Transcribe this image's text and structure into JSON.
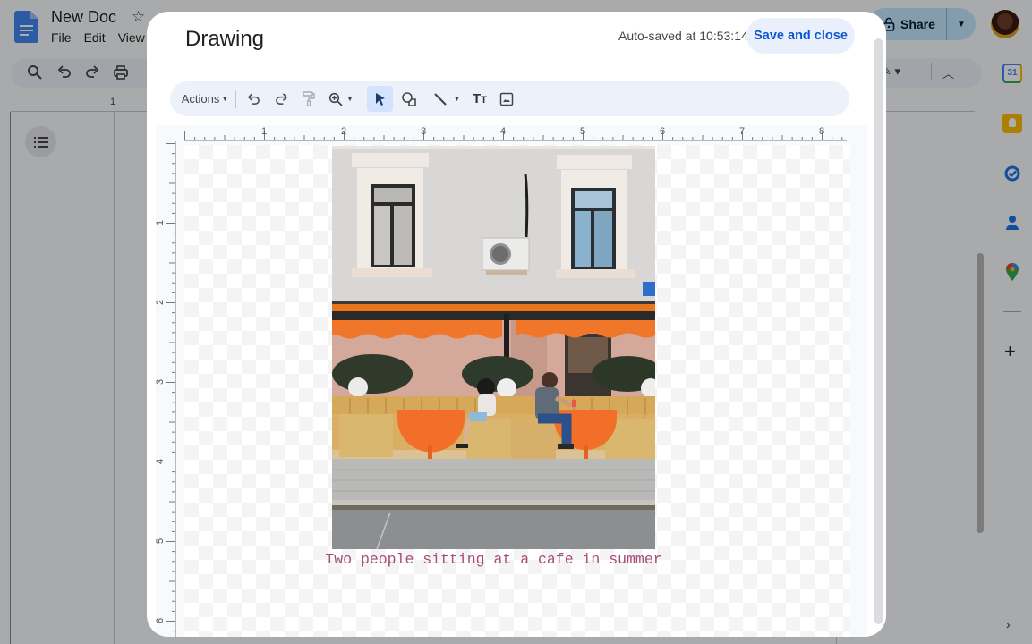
{
  "docs": {
    "title": "New Doc",
    "menu": [
      "File",
      "Edit",
      "View"
    ],
    "share_label": "Share",
    "ruler_mark": "1",
    "brand_color": "#4285f4"
  },
  "side_panel": {
    "apps": [
      "calendar",
      "keep",
      "tasks",
      "contacts",
      "maps"
    ],
    "calendar_day": "31"
  },
  "dialog": {
    "title": "Drawing",
    "autosave_text": "Auto-saved at 10:53:14",
    "save_close_label": "Save and close",
    "accent": "#0b57d0"
  },
  "toolbar": {
    "actions_label": "Actions",
    "tools": [
      "undo",
      "redo",
      "paint-format",
      "zoom",
      "select",
      "shape",
      "line",
      "text-box",
      "image"
    ],
    "active_tool": "select"
  },
  "rulers": {
    "horizontal": [
      "1",
      "2",
      "3",
      "4",
      "5",
      "6",
      "7",
      "8"
    ],
    "vertical": [
      "1",
      "2",
      "3",
      "4",
      "5",
      "6"
    ]
  },
  "canvas": {
    "image_alt": "Cafe storefront with orange awnings and two people sitting at orange tables",
    "caption": "Two people sitting at a cafe in summer",
    "caption_color": "#a64d79"
  }
}
